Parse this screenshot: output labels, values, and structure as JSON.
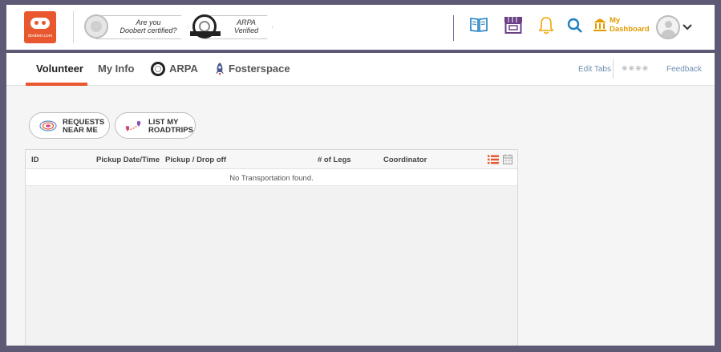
{
  "header": {
    "logo_text": "doobert.com",
    "badges": [
      {
        "text_line1": "Are you",
        "text_line2": "Doobert certified?"
      },
      {
        "text_line1": "ARPA",
        "text_line2": "Verified"
      }
    ],
    "dashboard_line1": "My",
    "dashboard_line2": "Dashboard"
  },
  "tabs": {
    "items": [
      "Volunteer",
      "My Info",
      "ARPA",
      "Fosterspace"
    ],
    "edit_tabs": "Edit Tabs",
    "feedback": "Feedback"
  },
  "actions": {
    "requests_line1": "REQUESTS",
    "requests_line2": "NEAR ME",
    "roadtrips_line1": "LIST MY",
    "roadtrips_line2": "ROADTRIPS"
  },
  "table": {
    "columns": [
      "ID",
      "Pickup Date/Time",
      "Pickup / Drop off",
      "# of Legs",
      "Coordinator"
    ],
    "empty_message": "No Transportation found."
  },
  "colors": {
    "brand": "#e8572d",
    "accent_header": "#5e5a75",
    "icon_purple": "#6b3f86",
    "icon_orange": "#f0a500",
    "icon_blue": "#1f7fc0"
  }
}
